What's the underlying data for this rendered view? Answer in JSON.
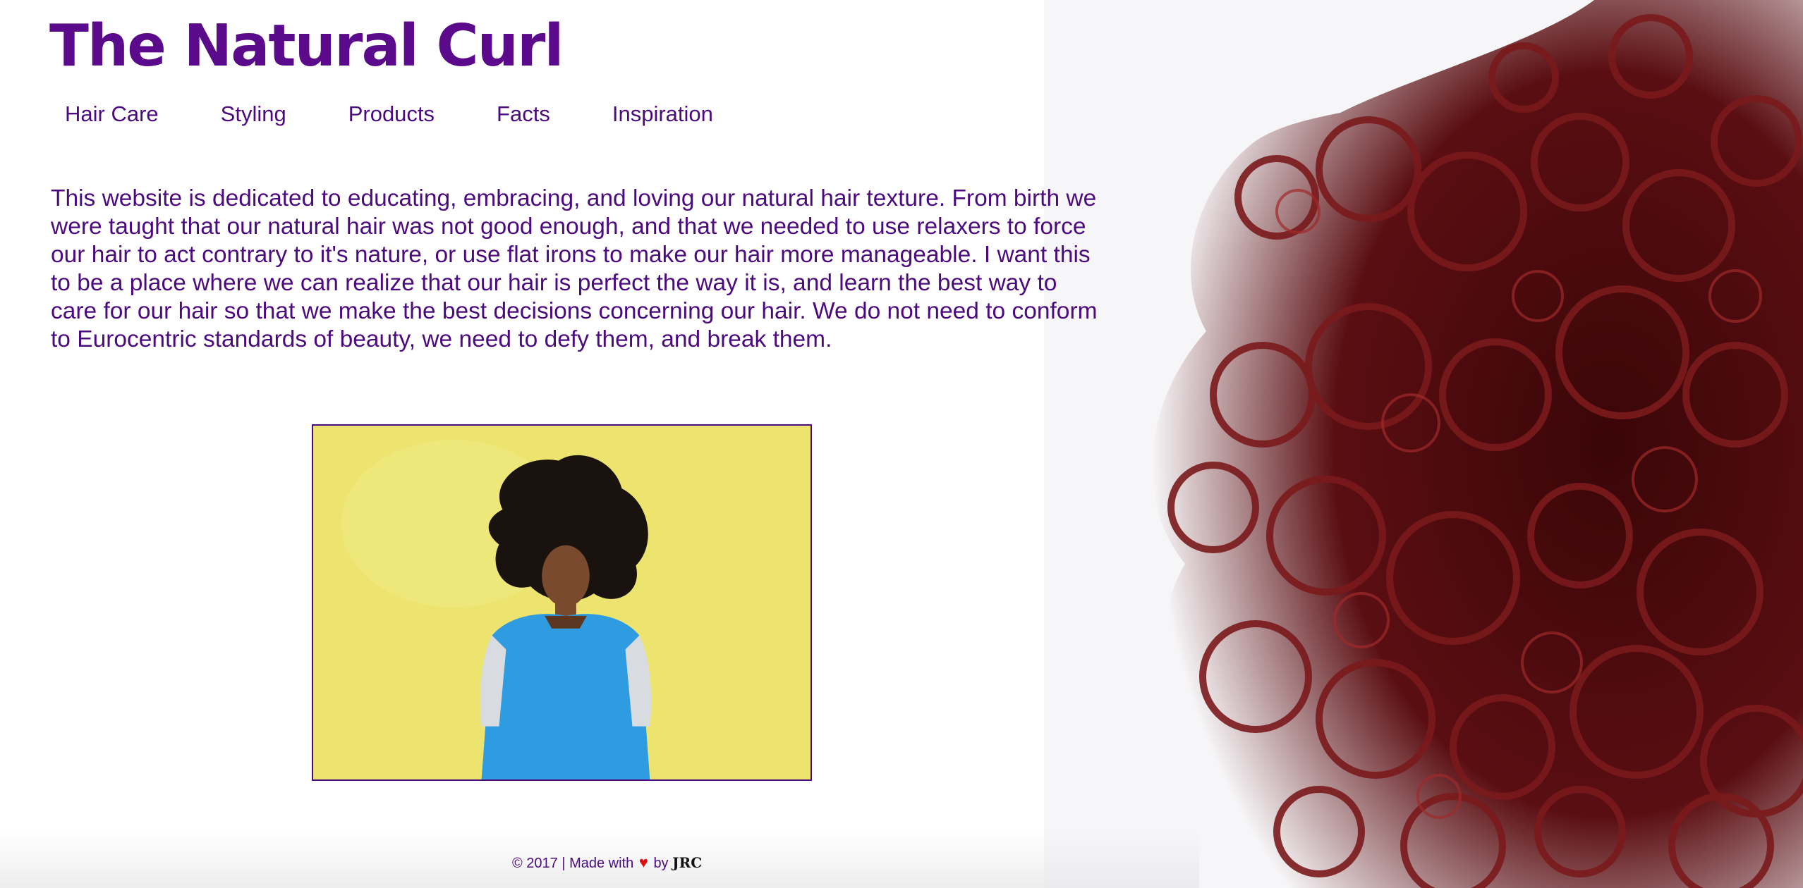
{
  "site": {
    "title": "The Natural Curl"
  },
  "nav": {
    "items": [
      {
        "label": "Hair Care"
      },
      {
        "label": "Styling"
      },
      {
        "label": "Products"
      },
      {
        "label": "Facts"
      },
      {
        "label": "Inspiration"
      }
    ]
  },
  "intro": {
    "text": "This website is dedicated to educating, embracing, and loving our natural hair texture. From birth we were taught that our natural hair was not good enough, and that we needed to use relaxers to force our hair to act contrary to it's nature, or use flat irons to make our hair more manageable. I want this to be a place where we can realize that our hair is perfect the way it is, and learn the best way to care for our hair so that we make the best decisions concerning our hair. We do not need to conform to Eurocentric standards of beauty, we need to defy them, and break them."
  },
  "footer": {
    "prefix": "© 2017 | Made with",
    "heart": "♥",
    "by": "by",
    "signature": "JRC"
  },
  "colors": {
    "brand_purple": "#4b0a7e",
    "heart_red": "#e01010",
    "photo_yellow": "#ece46e",
    "hair_red": "#6e1416"
  }
}
